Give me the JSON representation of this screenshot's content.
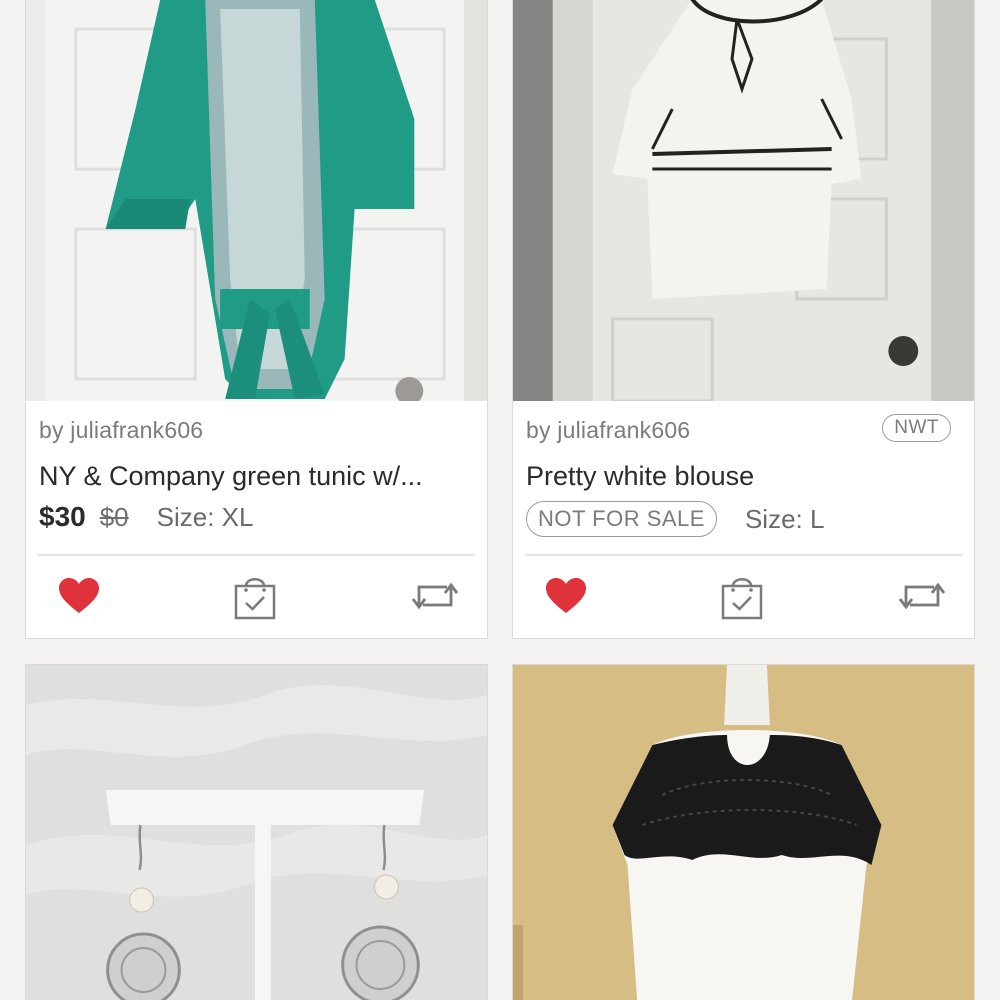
{
  "colors": {
    "accent_heart": "#e0323a",
    "icon_gray": "#7a7a7a",
    "background": "#f4f3f1"
  },
  "listings": [
    {
      "seller": "by juliafrank606",
      "title": "NY & Company green tunic w/...",
      "price": "$30",
      "original_price": "$0",
      "size": "Size: XL",
      "liked": true
    },
    {
      "seller": "by juliafrank606",
      "badge": "NWT",
      "title": "Pretty white blouse",
      "status": "NOT FOR SALE",
      "size": "Size: L",
      "liked": true
    },
    {
      "image": "silver-pearl-earrings-photo"
    },
    {
      "image": "black-lace-top-photo"
    }
  ],
  "icons": {
    "like": "heart-icon",
    "bundle": "shopping-bag-check-icon",
    "share": "share-icon"
  }
}
